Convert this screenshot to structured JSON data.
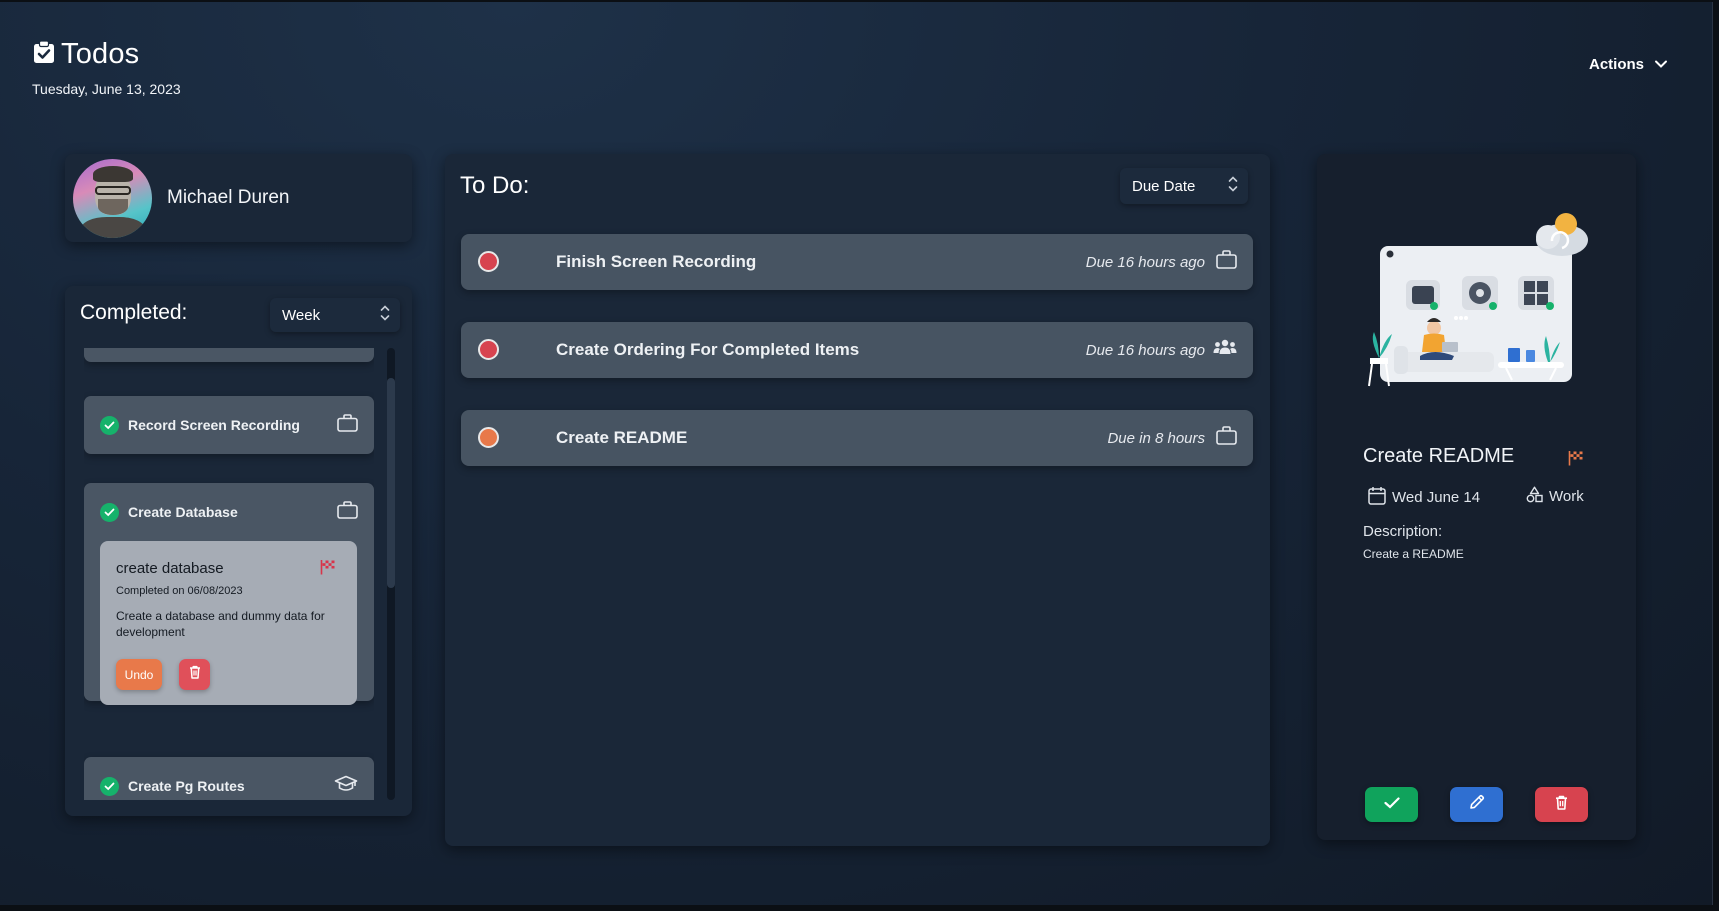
{
  "header": {
    "title": "Todos",
    "date": "Tuesday, June 13, 2023",
    "actions_label": "Actions"
  },
  "profile": {
    "name": "Michael Duren"
  },
  "completed": {
    "heading": "Completed:",
    "range_selected": "Week",
    "items": [
      {
        "label": "Record Screen Recording",
        "icon": "briefcase-icon"
      },
      {
        "label": "Create Database",
        "icon": "briefcase-icon",
        "expanded": true,
        "detail": {
          "title": "create database",
          "completed_on": "Completed on 06/08/2023",
          "description": "Create a database and dummy data for development",
          "undo_label": "Undo"
        }
      },
      {
        "label": "Create Pg Routes",
        "icon": "graduation-cap-icon"
      }
    ]
  },
  "todo": {
    "heading": "To Do:",
    "sort_selected": "Due Date",
    "tasks": [
      {
        "label": "Finish Screen Recording",
        "due": "Due 16 hours ago",
        "icon": "briefcase-icon",
        "status_color": "#e0505a"
      },
      {
        "label": "Create Ordering For Completed Items",
        "due": "Due 16 hours ago",
        "icon": "people-group-icon",
        "status_color": "#e0505a"
      },
      {
        "label": "Create README",
        "due": "Due in 8 hours",
        "icon": "briefcase-icon",
        "status_color": "#e8794a"
      }
    ]
  },
  "selected_task": {
    "title": "Create README",
    "date": "Wed June 14",
    "category": "Work",
    "description_label": "Description:",
    "description": "Create a README"
  },
  "colors": {
    "complete": "#10a35c",
    "edit": "#2f6fd1",
    "delete": "#d7434f",
    "overdue": "#e0505a",
    "upcoming": "#e8794a"
  }
}
